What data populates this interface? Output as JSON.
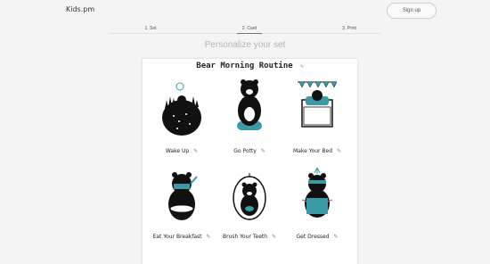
{
  "header": {
    "brand": "Kids.pm",
    "signup_label": "Sign up"
  },
  "steps": [
    {
      "label": "1. Set"
    },
    {
      "label": "2. Card"
    },
    {
      "label": "3. Print"
    }
  ],
  "subtitle": "Personalize your set",
  "card": {
    "title": "Bear Morning Routine",
    "edit_icon": "pencil-icon",
    "tiles": [
      {
        "label": "Wake Up"
      },
      {
        "label": "Go Potty"
      },
      {
        "label": "Make Your Bed"
      },
      {
        "label": "Eat Your Breakfast"
      },
      {
        "label": "Brush Your Teeth"
      },
      {
        "label": "Get Dressed"
      }
    ]
  },
  "colors": {
    "accent": "#e24a4a",
    "teal": "#3a9aa8",
    "ink": "#111111"
  }
}
